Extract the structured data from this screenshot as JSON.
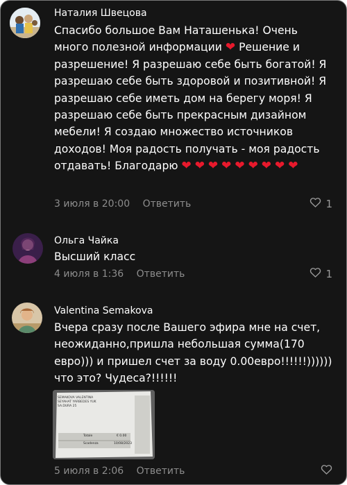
{
  "comments": [
    {
      "author": "Наталия Швецова",
      "text": "Спасибо большое Вам Наташенька! Очень много полезной информации",
      "text_2": "Решение и разрешение! Я разрешаю себе быть богатой! Я разрешаю себе быть здоровой и позитивной! Я разрешаю себе иметь дом на берегу моря! Я разрешаю себе быть прекрасным дизайном мебели! Я создаю множество источников доходов! Моя радость получать - моя радость отдавать! Благодарю",
      "time": "3 июля в 20:00",
      "reply": "Ответить",
      "likes": "1"
    },
    {
      "author": "Ольга Чайка",
      "text": "Высший класс",
      "time": "4 июля в 1:36",
      "reply": "Ответить",
      "likes": "1"
    },
    {
      "author": "Valentina Semakova",
      "text": "Вчера сразу после Вашего эфира мне на счет, неожиданно,пришла небольшая сумма(170 евро))) и пришел счет за воду 0.00евро!!!!!!)))))) что это? Чудеса?!!!!!!",
      "time": "5 июля в 2:06",
      "reply": "Ответить",
      "attachment": {
        "lines": [
          "SEMAKOVA VALENTINA",
          "SEYAHAT YARBEDES YUK",
          "SA.DURA 25"
        ],
        "totale_label": "Totale",
        "totale_value": "€ 0.00",
        "scadenza_label": "Scadenza",
        "scadenza_value": "10/08/2023"
      }
    }
  ],
  "icons": {
    "heart_emoji": "heart-emoji",
    "like": "heart-outline-icon"
  },
  "colors": {
    "background": "#151515",
    "muted": "#8d8d8d",
    "heart": "#e8192c"
  }
}
